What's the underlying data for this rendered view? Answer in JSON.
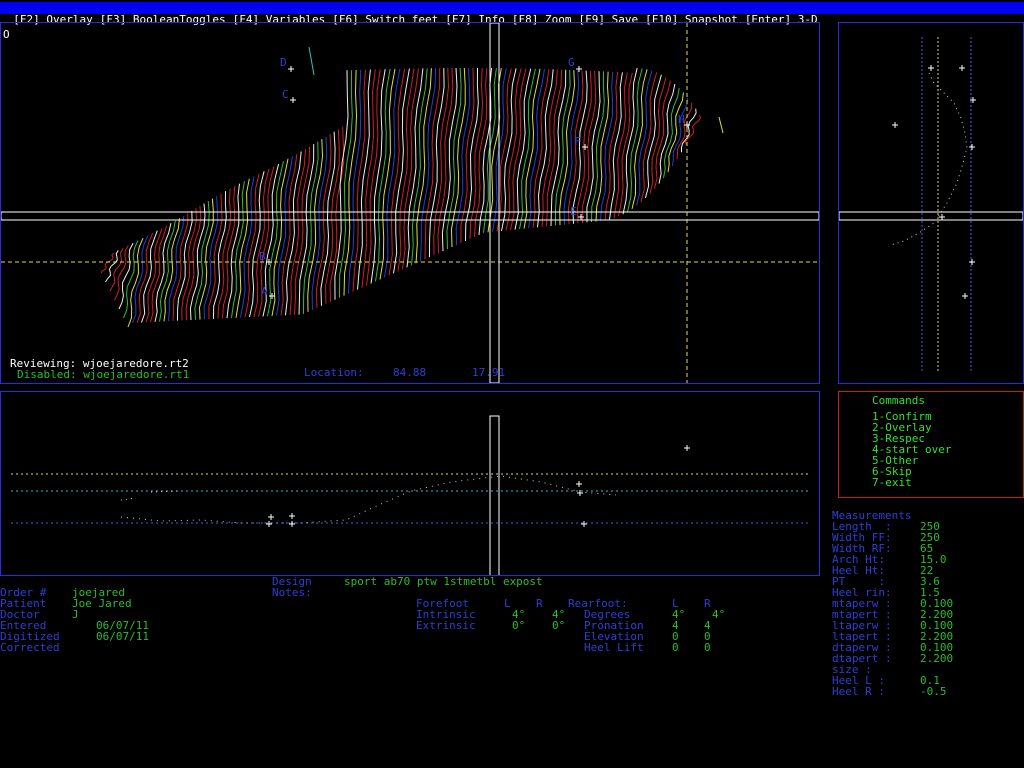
{
  "menu": [
    "[F2] Overlay",
    "[F3] BooleanToggles",
    "[F4] Variables",
    "[F6] Switch feet",
    "[F7] Info",
    "[F8] Zoom",
    "[F9] Save",
    "[F10] Snapshot",
    "[Enter] 3-D"
  ],
  "top_panel": {
    "corner_label": "O",
    "reviewing_label": "Reviewing: wjoejaredore.rt2",
    "disabled_label": "Disabled: wjoejaredore.rt1",
    "location_label": "Location:",
    "location_x": "84.88",
    "location_y": "17.91",
    "point_labels": [
      "D",
      "C",
      "G",
      "F",
      "E",
      "B",
      "A",
      "H"
    ]
  },
  "commands": {
    "title": "Commands",
    "items": [
      "1-Confirm",
      "2-Overlay",
      "3-Respec",
      "4-start over",
      "5-Other",
      "6-Skip",
      "7-exit"
    ]
  },
  "measurements": {
    "title": "Measurements",
    "rows": [
      {
        "label": "Length  :",
        "value": "250"
      },
      {
        "label": "Width FF:",
        "value": "250"
      },
      {
        "label": "Width RF:",
        "value": "65"
      },
      {
        "label": "Arch Ht:",
        "value": "15.0"
      },
      {
        "label": "Heel Ht:",
        "value": "22"
      },
      {
        "label": "PT     :",
        "value": "3.6"
      },
      {
        "label": "Heel rin:",
        "value": "1.5"
      },
      {
        "label": "mtaperw :",
        "value": "0.100"
      },
      {
        "label": "mtapert :",
        "value": "2.200"
      },
      {
        "label": "ltaperw :",
        "value": "0.100"
      },
      {
        "label": "ltapert :",
        "value": "2.200"
      },
      {
        "label": "dtaperw :",
        "value": "0.100"
      },
      {
        "label": "dtapert :",
        "value": "2.200"
      },
      {
        "label": "size :",
        "value": ""
      },
      {
        "label": "Heel L :",
        "value": "0.1"
      },
      {
        "label": "Heel R :",
        "value": "-0.5"
      }
    ]
  },
  "order": {
    "order_label": "Order #",
    "order_value": "joejared",
    "patient_label": "Patient",
    "patient_value": "Joe Jared",
    "doctor_label": "Doctor",
    "doctor_value": "J",
    "entered_label": "Entered",
    "entered_value": "06/07/11",
    "digitized_label": "Digitized",
    "digitized_value": "06/07/11",
    "corrected_label": "Corrected"
  },
  "design": {
    "design_label": "Design",
    "design_value": "sport ab70 ptw 1stmetbl expost",
    "notes_label": "Notes:"
  },
  "posting": {
    "forefoot_label": "Forefoot",
    "L": "L",
    "R": "R",
    "intrinsic_label": "Intrinsic",
    "intrinsic_L": "4°",
    "intrinsic_R": "4°",
    "extrinsic_label": "Extrinsic",
    "extrinsic_L": "0°",
    "extrinsic_R": "0°",
    "rearfoot_label": "Rearfoot:",
    "degrees_label": "Degrees",
    "degrees_L": "4°",
    "degrees_R": "4°",
    "pronation_label": "Pronation",
    "pronation_L": "4",
    "pronation_R": "4",
    "elevation_label": "Elevation",
    "elevation_L": "0",
    "elevation_R": "0",
    "heellift_label": "Heel Lift",
    "heellift_L": "0",
    "heellift_R": "0"
  },
  "colors": {
    "menu_bg": "#0000f0",
    "panel_border": "#2a2adc",
    "green": "#2bbd2b",
    "blue": "#2d3fd6",
    "yellow": "#e0e040"
  }
}
